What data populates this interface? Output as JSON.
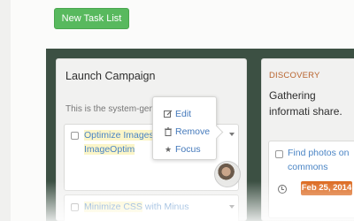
{
  "toolbar": {
    "new_task_list_label": "New Task List"
  },
  "lists": [
    {
      "title": "Launch Campaign",
      "subtitle": "This is the system-generated",
      "tasks": [
        {
          "text_part1": "Optimize Images",
          "text_part2": "ImageOptim",
          "text_tail": ""
        },
        {
          "text_part1": "Minimize CSS",
          "text_part2": "with Minus"
        }
      ],
      "menu": {
        "edit": "Edit",
        "remove": "Remove",
        "focus": "Focus"
      }
    },
    {
      "category": "DISCOVERY",
      "title": "Gathering informati share.",
      "tasks": [
        {
          "text": "Find photos on commons",
          "due": "Feb 25, 2014"
        }
      ]
    }
  ],
  "icons": [
    "pencil-icon",
    "trash-icon",
    "star-icon",
    "clock-icon",
    "caret-down-icon"
  ],
  "colors": {
    "primary": "#58b95e",
    "board": "#3c5043",
    "link": "#4b85c5",
    "due": "#dc6b22",
    "category": "#b8642e"
  }
}
